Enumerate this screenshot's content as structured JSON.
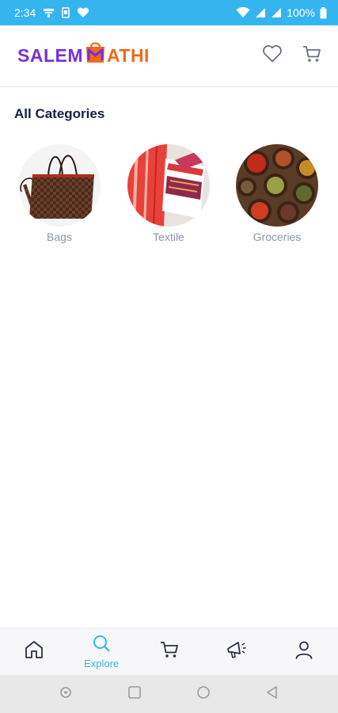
{
  "status_bar": {
    "time": "2:34",
    "battery": "100%"
  },
  "header": {
    "logo_part1": "SALEM",
    "logo_part2": "ATHI",
    "logo_bag_letter": "M"
  },
  "section": {
    "title": "All Categories"
  },
  "categories": [
    {
      "label": "Bags",
      "image": "handbag-photo"
    },
    {
      "label": "Textile",
      "image": "saree-fabric-photo"
    },
    {
      "label": "Groceries",
      "image": "spices-photo"
    }
  ],
  "bottom_nav": {
    "items": [
      {
        "icon": "home-icon",
        "label": ""
      },
      {
        "icon": "search-icon",
        "label": "Explore"
      },
      {
        "icon": "cart-icon",
        "label": ""
      },
      {
        "icon": "megaphone-icon",
        "label": ""
      },
      {
        "icon": "profile-icon",
        "label": ""
      }
    ],
    "active_color": "#35b5ef"
  },
  "colors": {
    "status_bar": "#35b5ef",
    "logo_purple": "#7a2fd6",
    "logo_orange": "#f06a1a",
    "title": "#14204a",
    "label": "#8e95a8"
  }
}
